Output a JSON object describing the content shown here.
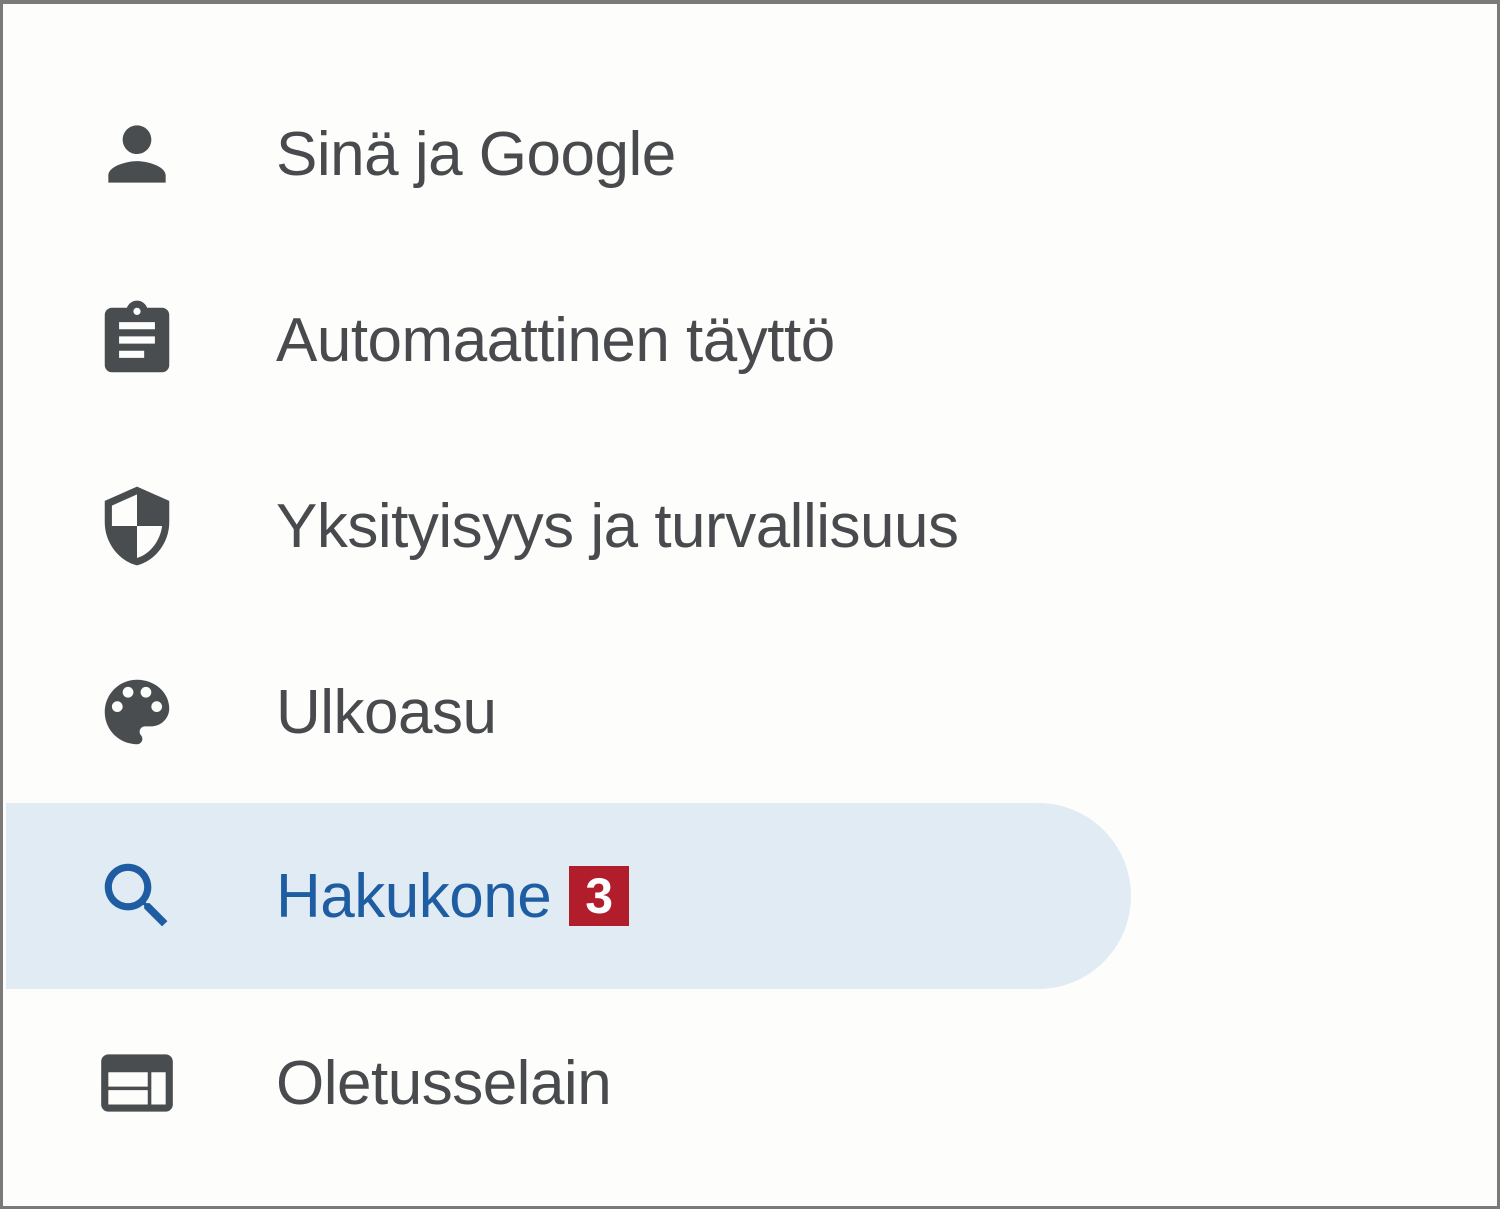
{
  "nav": {
    "items": [
      {
        "label": "Sinä ja Google",
        "icon": "person-icon",
        "selected": false
      },
      {
        "label": "Automaattinen täyttö",
        "icon": "clipboard-icon",
        "selected": false
      },
      {
        "label": "Yksityisyys ja turvallisuus",
        "icon": "shield-icon",
        "selected": false
      },
      {
        "label": "Ulkoasu",
        "icon": "palette-icon",
        "selected": false
      },
      {
        "label": "Hakukone",
        "icon": "search-icon",
        "selected": true,
        "badge": "3"
      },
      {
        "label": "Oletusselain",
        "icon": "browser-window-icon",
        "selected": false
      }
    ]
  },
  "colors": {
    "text": "#484a4d",
    "icon": "#4a4d50",
    "selected_text": "#1f5da3",
    "selected_background": "#e0ebf3",
    "badge_background": "#b11d2a",
    "badge_text": "#ffffff"
  }
}
